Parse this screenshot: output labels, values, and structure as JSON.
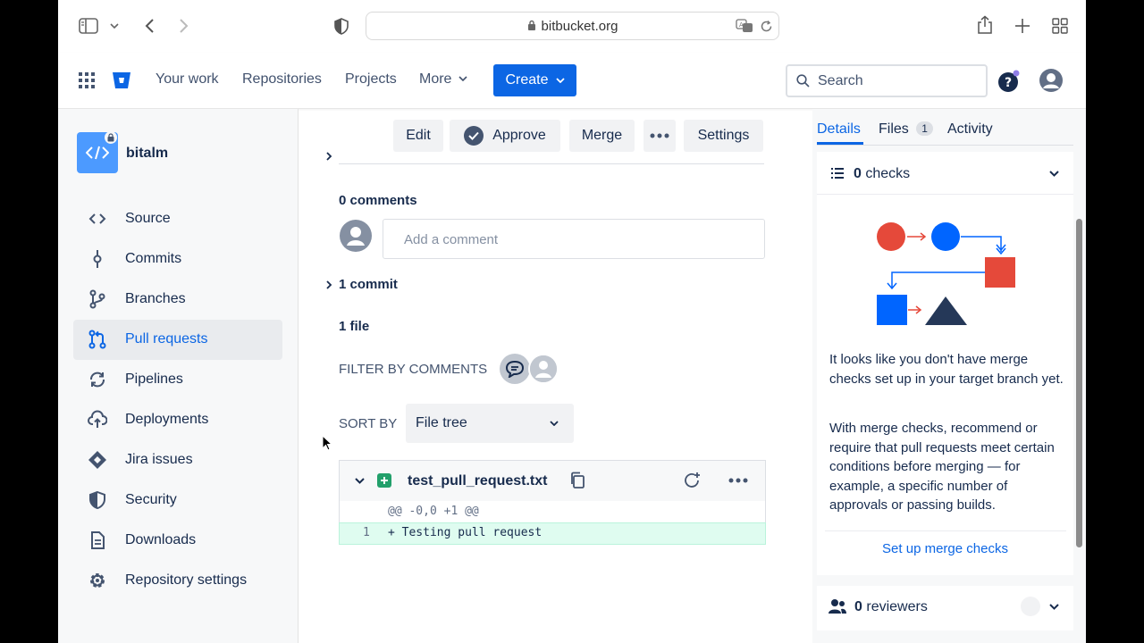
{
  "browser": {
    "url": "bitbucket.org"
  },
  "nav": {
    "your_work": "Your work",
    "repositories": "Repositories",
    "projects": "Projects",
    "more": "More",
    "create": "Create",
    "search_placeholder": "Search"
  },
  "sidebar": {
    "repo_name": "bitalm",
    "items": [
      {
        "label": "Source",
        "icon": "code-icon"
      },
      {
        "label": "Commits",
        "icon": "commit-icon"
      },
      {
        "label": "Branches",
        "icon": "branch-icon"
      },
      {
        "label": "Pull requests",
        "icon": "pull-request-icon",
        "active": true
      },
      {
        "label": "Pipelines",
        "icon": "pipelines-icon"
      },
      {
        "label": "Deployments",
        "icon": "deployments-icon"
      },
      {
        "label": "Jira issues",
        "icon": "jira-icon"
      },
      {
        "label": "Security",
        "icon": "shield-icon"
      },
      {
        "label": "Downloads",
        "icon": "document-icon"
      },
      {
        "label": "Repository settings",
        "icon": "gear-icon"
      }
    ]
  },
  "toolbar": {
    "edit": "Edit",
    "approve": "Approve",
    "merge": "Merge",
    "settings": "Settings"
  },
  "main": {
    "comments_count": "0 comments",
    "comment_placeholder": "Add a comment",
    "commits": "1 commit",
    "files": "1 file",
    "filter_by_comments": "FILTER BY COMMENTS",
    "sort_by": "SORT BY",
    "sort_value": "File tree",
    "file": {
      "name": "test_pull_request.txt",
      "hunk_header": "@@ -0,0 +1 @@",
      "line_number": "1",
      "line_content": "+ Testing pull request"
    }
  },
  "right_panel": {
    "tabs": {
      "details": "Details",
      "files": "Files",
      "files_count": "1",
      "activity": "Activity"
    },
    "checks_count": "0",
    "checks_label": "checks",
    "checks_message": "It looks like you don't have merge checks set up in your target branch yet.",
    "checks_description": "With merge checks, recommend or require that pull requests meet certain conditions before merging — for example, a specific number of approvals or passing builds.",
    "setup_link": "Set up merge checks",
    "reviewers_count": "0",
    "reviewers_label": "reviewers"
  },
  "colors": {
    "brand_blue": "#0C66E4",
    "illustration_red": "#E5493A",
    "illustration_blue": "#0065FF",
    "illustration_dark": "#253858"
  }
}
